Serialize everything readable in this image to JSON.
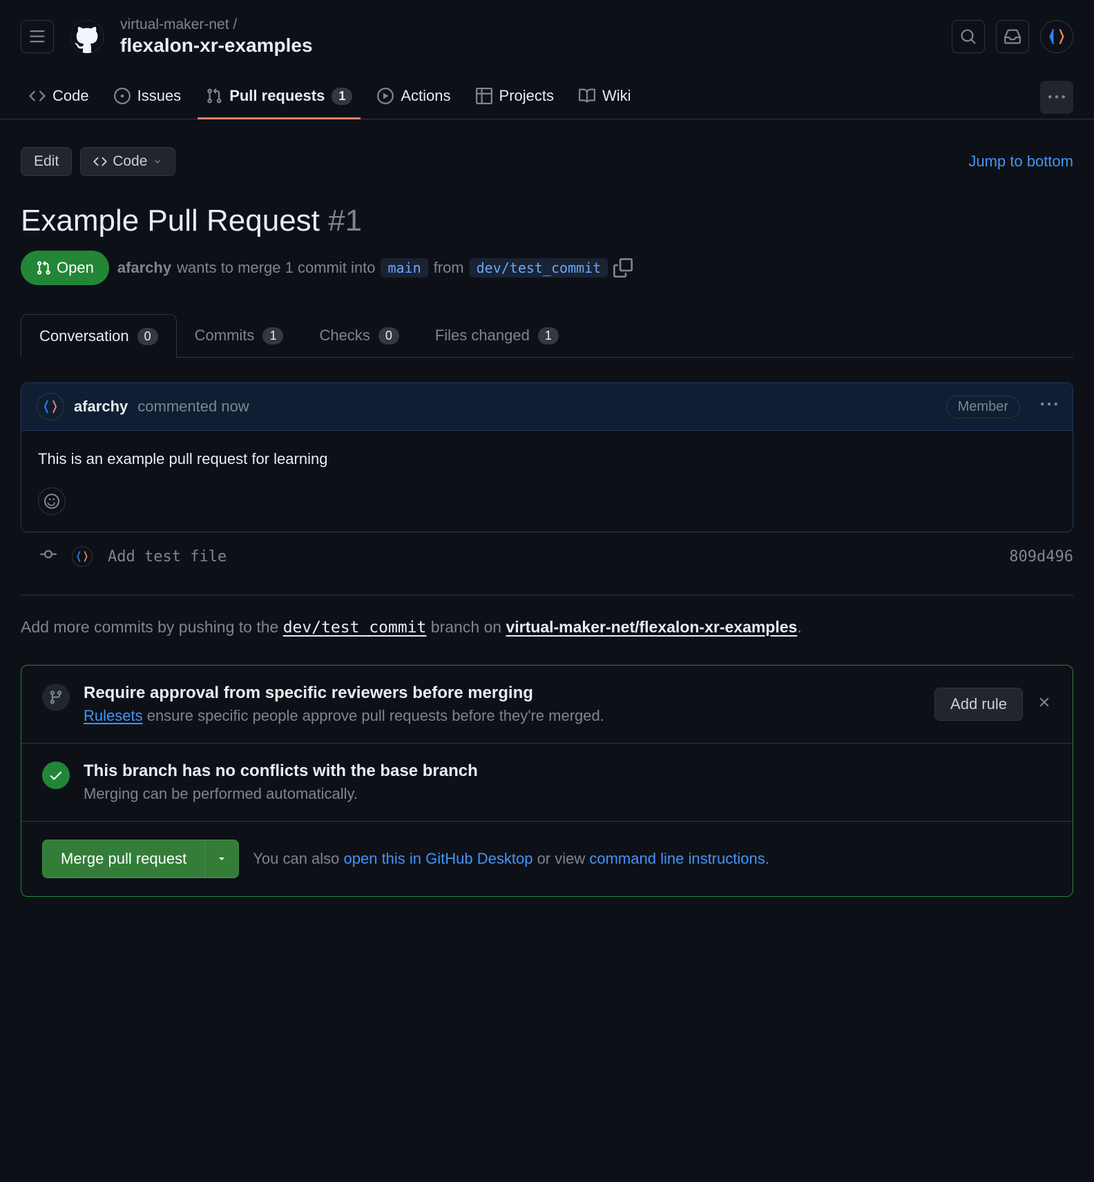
{
  "header": {
    "org": "virtual-maker-net /",
    "repo": "flexalon-xr-examples"
  },
  "repoTabs": {
    "code": "Code",
    "issues": "Issues",
    "pullRequests": "Pull requests",
    "pullRequestsCount": "1",
    "actions": "Actions",
    "projects": "Projects",
    "wiki": "Wiki"
  },
  "toolbar": {
    "edit": "Edit",
    "code": "Code",
    "jump": "Jump to bottom"
  },
  "pr": {
    "title": "Example Pull Request",
    "number": "#1",
    "status": "Open",
    "author": "afarchy",
    "wantsText": "wants to merge 1 commit into",
    "baseBranch": "main",
    "fromText": "from",
    "headBranch": "dev/test_commit"
  },
  "prTabs": {
    "conversation": "Conversation",
    "conversationCount": "0",
    "commits": "Commits",
    "commitsCount": "1",
    "checks": "Checks",
    "checksCount": "0",
    "files": "Files changed",
    "filesCount": "1"
  },
  "comment": {
    "author": "afarchy",
    "action": "commented now",
    "badge": "Member",
    "body": "This is an example pull request for learning"
  },
  "commit": {
    "message": "Add test file",
    "sha": "809d496"
  },
  "pushHint": {
    "prefix": "Add more commits by pushing to the ",
    "branch": "dev/test_commit",
    "middle": " branch on ",
    "repo": "virtual-maker-net/flexalon-xr-examples",
    "suffix": "."
  },
  "ruleset": {
    "title": "Require approval from specific reviewers before merging",
    "linkText": "Rulesets",
    "desc": " ensure specific people approve pull requests before they're merged.",
    "addRule": "Add rule"
  },
  "conflicts": {
    "title": "This branch has no conflicts with the base branch",
    "desc": "Merging can be performed automatically."
  },
  "merge": {
    "button": "Merge pull request",
    "hintPrefix": "You can also ",
    "link1": "open this in GitHub Desktop",
    "hintMiddle": " or view ",
    "link2": "command line instructions",
    "hintSuffix": "."
  }
}
